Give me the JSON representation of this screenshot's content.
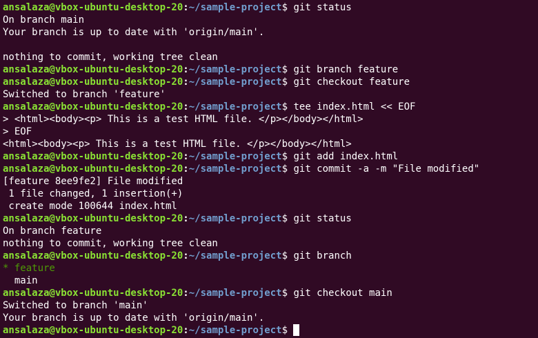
{
  "theme": {
    "background": "#300a24",
    "prompt_user_color": "#8ae234",
    "prompt_path_color": "#729fcf",
    "text_color": "#ffffff",
    "current_branch_color": "#4e9a06"
  },
  "prompt": {
    "user_host": "ansalaza@vbox-ubuntu-desktop-20",
    "separator": ":",
    "path": "~/sample-project",
    "symbol": "$"
  },
  "lines": [
    {
      "type": "prompt",
      "command": " git status"
    },
    {
      "type": "output",
      "text": "On branch main"
    },
    {
      "type": "output",
      "text": "Your branch is up to date with 'origin/main'."
    },
    {
      "type": "output",
      "text": ""
    },
    {
      "type": "output",
      "text": "nothing to commit, working tree clean"
    },
    {
      "type": "prompt",
      "command": " git branch feature"
    },
    {
      "type": "prompt",
      "command": " git checkout feature"
    },
    {
      "type": "output",
      "text": "Switched to branch 'feature'"
    },
    {
      "type": "prompt",
      "command": " tee index.html << EOF"
    },
    {
      "type": "output",
      "text": "> <html><body><p> This is a test HTML file. </p></body></html>"
    },
    {
      "type": "output",
      "text": "> EOF"
    },
    {
      "type": "output",
      "text": "<html><body><p> This is a test HTML file. </p></body></html>"
    },
    {
      "type": "prompt",
      "command": " git add index.html"
    },
    {
      "type": "prompt",
      "command": " git commit -a -m \"File modified\""
    },
    {
      "type": "output",
      "text": "[feature 8ee9fe2] File modified"
    },
    {
      "type": "output",
      "text": " 1 file changed, 1 insertion(+)"
    },
    {
      "type": "output",
      "text": " create mode 100644 index.html"
    },
    {
      "type": "prompt",
      "command": " git status"
    },
    {
      "type": "output",
      "text": "On branch feature"
    },
    {
      "type": "output",
      "text": "nothing to commit, working tree clean"
    },
    {
      "type": "prompt",
      "command": " git branch"
    },
    {
      "type": "current-branch",
      "marker": "* ",
      "text": "feature"
    },
    {
      "type": "output",
      "text": "  main"
    },
    {
      "type": "prompt",
      "command": " git checkout main"
    },
    {
      "type": "output",
      "text": "Switched to branch 'main'"
    },
    {
      "type": "output",
      "text": "Your branch is up to date with 'origin/main'."
    },
    {
      "type": "prompt",
      "command": " ",
      "cursor": true
    }
  ]
}
